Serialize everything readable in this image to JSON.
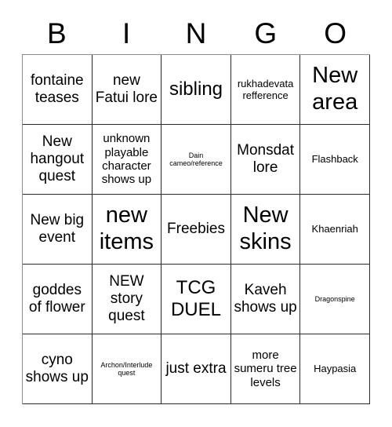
{
  "card": {
    "header_letters": [
      "B",
      "I",
      "N",
      "G",
      "O"
    ],
    "rows": [
      [
        {
          "text": "fontaine teases",
          "size": "md"
        },
        {
          "text": "new Fatui lore",
          "size": "md"
        },
        {
          "text": "sibling",
          "size": "lg"
        },
        {
          "text": "rukhadevata refference",
          "size": "xs"
        },
        {
          "text": "New area",
          "size": "xl"
        }
      ],
      [
        {
          "text": "New hangout quest",
          "size": "md"
        },
        {
          "text": "unknown playable character shows up",
          "size": "sm"
        },
        {
          "text": "Dain cameo/reference",
          "size": "xxs"
        },
        {
          "text": "Monsdat lore",
          "size": "md"
        },
        {
          "text": "Flashback",
          "size": "xs"
        }
      ],
      [
        {
          "text": "New big event",
          "size": "md"
        },
        {
          "text": "new items",
          "size": "xl"
        },
        {
          "text": "Freebies",
          "size": "md"
        },
        {
          "text": "New skins",
          "size": "xl"
        },
        {
          "text": "Khaenriah",
          "size": "xs"
        }
      ],
      [
        {
          "text": "goddes of flower",
          "size": "md"
        },
        {
          "text": "NEW story quest",
          "size": "md"
        },
        {
          "text": "TCG DUEL",
          "size": "lg"
        },
        {
          "text": "Kaveh shows up",
          "size": "md"
        },
        {
          "text": "Dragonspine",
          "size": "xxs"
        }
      ],
      [
        {
          "text": "cyno shows up",
          "size": "md"
        },
        {
          "text": "Archon/Interlude quest",
          "size": "xxs"
        },
        {
          "text": "just extra",
          "size": "md"
        },
        {
          "text": "more sumeru tree levels",
          "size": "sm"
        },
        {
          "text": "Haypasia",
          "size": "xs"
        }
      ]
    ],
    "colors": {
      "background": "#ffffff",
      "text": "#000000",
      "grid_line": "#2b2b2b"
    }
  }
}
